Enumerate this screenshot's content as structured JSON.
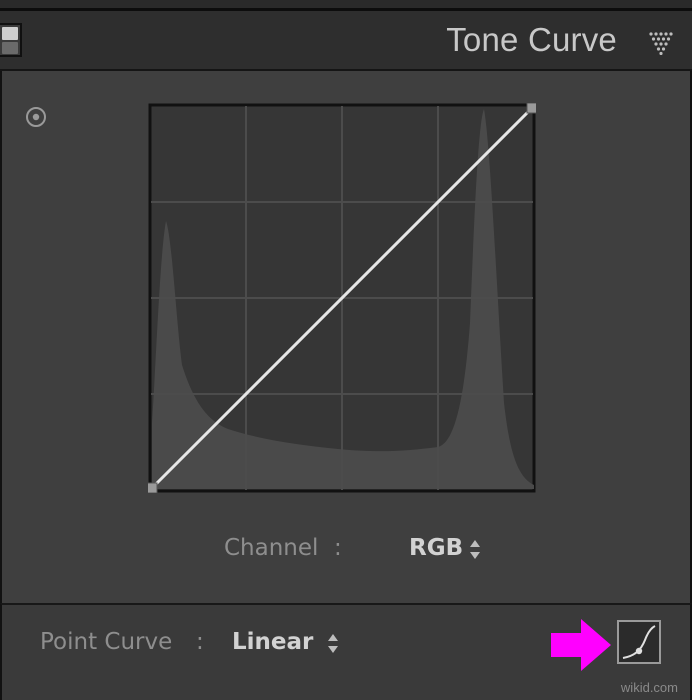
{
  "panel": {
    "title": "Tone Curve"
  },
  "channel": {
    "label": "Channel",
    "colon": ":",
    "value": "RGB"
  },
  "point_curve": {
    "label": "Point Curve",
    "colon": ":",
    "value": "Linear"
  },
  "watermark": "wikid.com",
  "icons": {
    "panel_switch": "toggle-switch-icon",
    "collapse": "triangle-down-icon",
    "targeted_adjustment": "target-icon",
    "arrow": "arrow-right-icon",
    "edit_point_curve": "curve-edit-icon"
  },
  "colors": {
    "accent_arrow": "#ff00ff",
    "curve_line": "#e6e6e6",
    "graph_bg": "#363636",
    "panel_bg": "#3f3f3f"
  }
}
